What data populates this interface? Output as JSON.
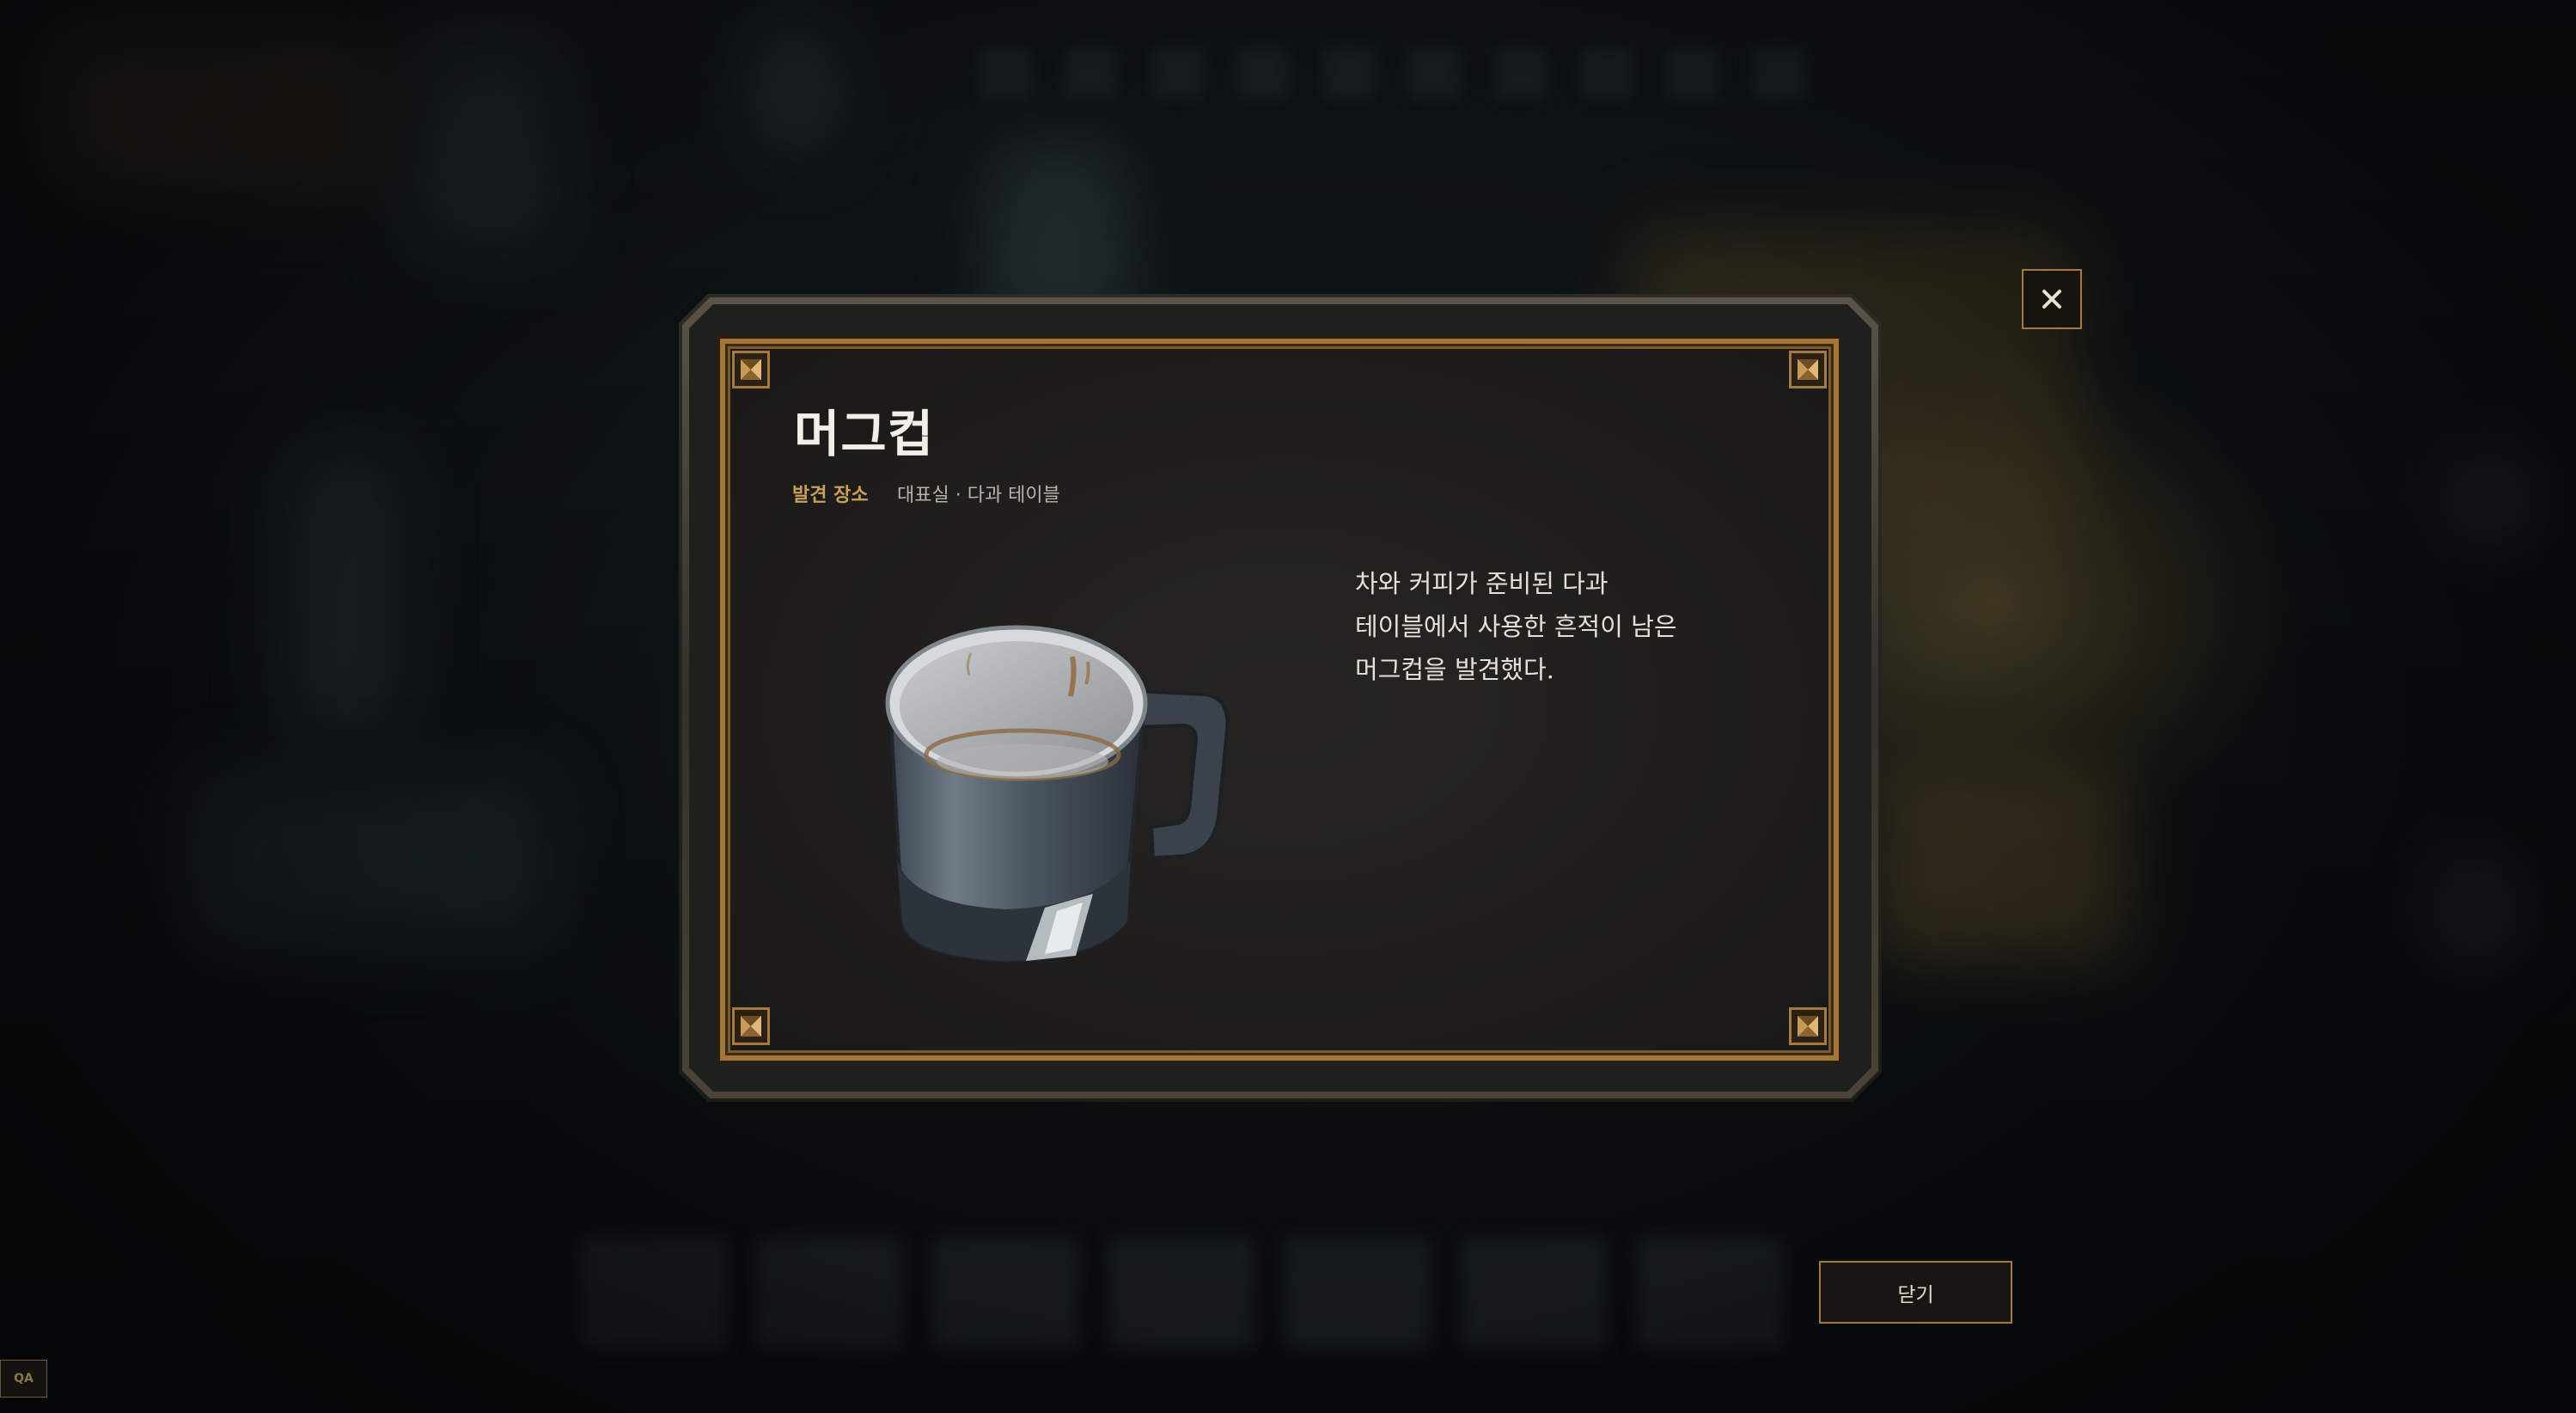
{
  "item": {
    "title": "머그컵",
    "location_label": "발견 장소",
    "location_value": "대표실 · 다과 테이블",
    "description_lines": [
      "차와 커피가 준비된 다과",
      "테이블에서 사용한 흔적이 남은",
      "머그컵을 발견했다."
    ],
    "image_icon": "mug-image"
  },
  "buttons": {
    "close_icon": "close-icon",
    "close_label": "닫기"
  },
  "debug": {
    "qa_label": "QA"
  },
  "colors": {
    "frame_gold": "#a4763a",
    "label_gold": "#c9a05a",
    "panel_bg": "#1f1e1c"
  }
}
